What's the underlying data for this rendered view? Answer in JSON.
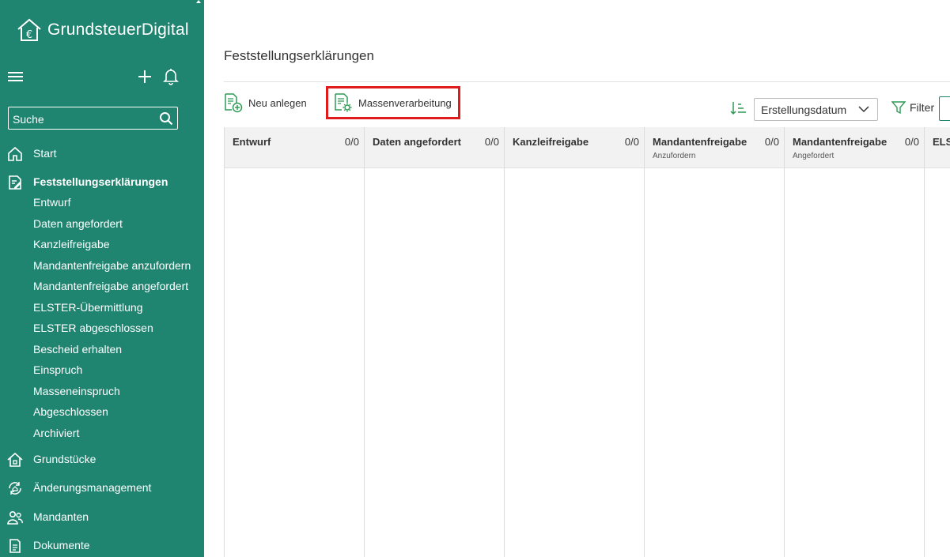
{
  "app": {
    "brand": "GrundsteuerDigital"
  },
  "sidebar": {
    "search_placeholder": "Suche",
    "nav": [
      {
        "label": "Start",
        "icon": "home-icon"
      },
      {
        "label": "Feststellungserklärungen",
        "icon": "document-edit-icon",
        "active": true
      },
      {
        "label": "Grundstücke",
        "icon": "house-icon"
      },
      {
        "label": "Änderungsmanagement",
        "icon": "change-management-icon"
      },
      {
        "label": "Mandanten",
        "icon": "users-icon"
      },
      {
        "label": "Dokumente",
        "icon": "document-icon"
      }
    ],
    "subitems": [
      "Entwurf",
      "Daten angefordert",
      "Kanzleifreigabe",
      "Mandantenfreigabe anzufordern",
      "Mandantenfreigabe angefordert",
      "ELSTER-Übermittlung",
      "ELSTER abgeschlossen",
      "Bescheid erhalten",
      "Einspruch",
      "Masseneinspruch",
      "Abgeschlossen",
      "Archiviert"
    ]
  },
  "main": {
    "title": "Feststellungserklärungen",
    "toolbar": {
      "new_label": "Neu anlegen",
      "mass_label": "Massenverarbeitung",
      "sort_value": "Erstellungsdatum",
      "filter_label": "Filter"
    },
    "columns": [
      {
        "title": "Entwurf",
        "sub": "",
        "count": "0/0"
      },
      {
        "title": "Daten angefordert",
        "sub": "",
        "count": "0/0"
      },
      {
        "title": "Kanzleifreigabe",
        "sub": "",
        "count": "0/0"
      },
      {
        "title": "Mandantenfreigabe",
        "sub": "Anzufordern",
        "count": "0/0"
      },
      {
        "title": "Mandantenfreigabe",
        "sub": "Angefordert",
        "count": "0/0"
      },
      {
        "title": "ELST",
        "sub": "",
        "count": ""
      }
    ]
  },
  "colors": {
    "sidebar_bg": "#1f8470",
    "accent": "#2e9a55",
    "highlight": "#e01b1b"
  }
}
